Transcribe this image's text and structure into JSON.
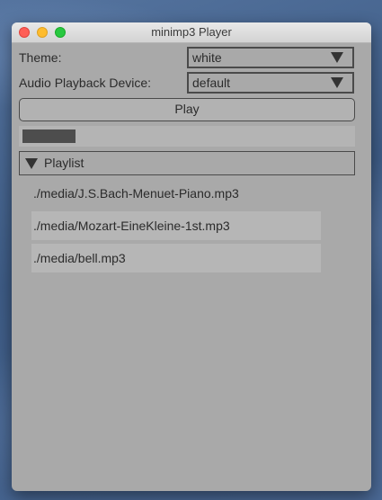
{
  "window": {
    "title": "minimp3 Player"
  },
  "settings": {
    "theme_label": "Theme:",
    "theme_value": "white",
    "device_label": "Audio Playback Device:",
    "device_value": "default"
  },
  "player": {
    "play_label": "Play",
    "progress_percent": 16
  },
  "playlist": {
    "header_label": "Playlist",
    "tracks": [
      "./media/J.S.Bach-Menuet-Piano.mp3",
      "./media/Mozart-EineKleine-1st.mp3",
      "./media/bell.mp3"
    ]
  }
}
